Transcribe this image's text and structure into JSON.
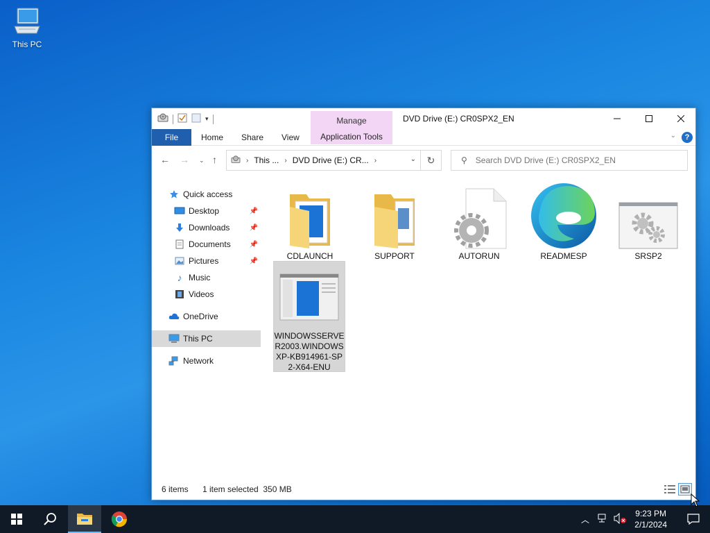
{
  "desktop": {
    "icons": [
      {
        "label": "This PC",
        "icon": "computer-icon"
      }
    ]
  },
  "window": {
    "title": "DVD Drive (E:) CR0SPX2_EN",
    "manage_tab": "Manage",
    "controls": {
      "minimize": "–",
      "maximize": "☐",
      "close": "✕"
    },
    "ribbon": {
      "tabs": [
        "File",
        "Home",
        "Share",
        "View",
        "Application Tools"
      ],
      "accent": "#1f5fae",
      "contextual_color": "#f3d6f5"
    },
    "address": {
      "crumbs": [
        "This ...",
        "DVD Drive (E:) CR..."
      ],
      "search_placeholder": "Search DVD Drive (E:) CR0SPX2_EN"
    },
    "sidebar": {
      "items": [
        {
          "label": "Quick access",
          "icon": "star-icon",
          "indent": 0
        },
        {
          "label": "Desktop",
          "icon": "desktop-icon",
          "indent": 1,
          "pinned": true
        },
        {
          "label": "Downloads",
          "icon": "download-arrow-icon",
          "indent": 1,
          "pinned": true
        },
        {
          "label": "Documents",
          "icon": "document-icon",
          "indent": 1,
          "pinned": true
        },
        {
          "label": "Pictures",
          "icon": "pictures-icon",
          "indent": 1,
          "pinned": true
        },
        {
          "label": "Music",
          "icon": "music-note-icon",
          "indent": 1
        },
        {
          "label": "Videos",
          "icon": "film-icon",
          "indent": 1
        },
        {
          "label": "OneDrive",
          "icon": "cloud-icon",
          "indent": 0
        },
        {
          "label": "This PC",
          "icon": "computer-icon",
          "indent": 0,
          "selected": true
        },
        {
          "label": "Network",
          "icon": "network-icon",
          "indent": 0
        }
      ]
    },
    "files": [
      {
        "name": "CDLAUNCH",
        "icon": "folder-icon"
      },
      {
        "name": "SUPPORT",
        "icon": "folder-icon"
      },
      {
        "name": "AUTORUN",
        "icon": "settings-file-icon"
      },
      {
        "name": "READMESP",
        "icon": "edge-icon"
      },
      {
        "name": "SRSP2",
        "icon": "gear-window-icon"
      },
      {
        "name": "WINDOWSSERVER2003.WINDOWSXP-KB914961-SP2-X64-ENU",
        "display_lines": [
          "WINDOWSSERVE",
          "R2003.WINDOWS",
          "XP-KB914961-SP",
          "2-X64-ENU"
        ],
        "icon": "installer-icon",
        "selected": true
      }
    ],
    "status": {
      "item_count": "6 items",
      "selection": "1 item selected  350 MB"
    }
  },
  "taskbar": {
    "clock_time": "9:23 PM",
    "clock_date": "2/1/2024",
    "bg": "#101a26"
  }
}
